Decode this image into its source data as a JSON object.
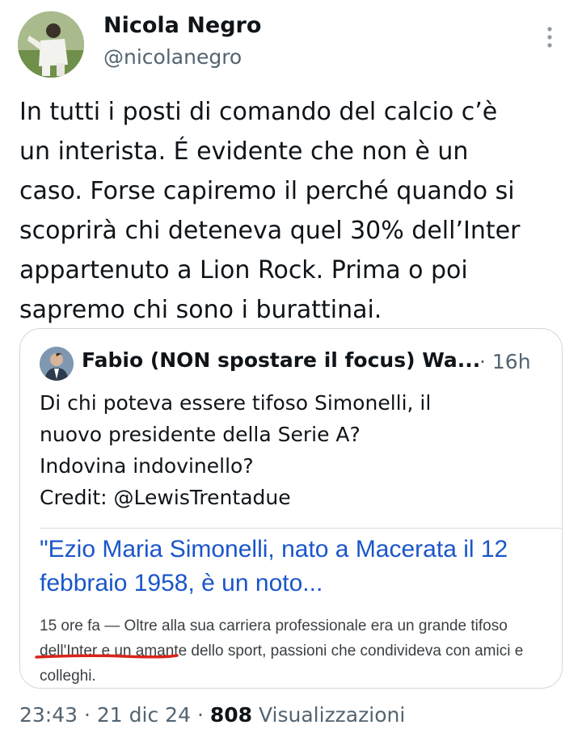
{
  "author": {
    "name": "Nicola Negro",
    "handle": "@nicolanegro"
  },
  "tweet": {
    "text": "In tutti i posti di comando del calcio c’è\nun interista. É evidente che non è un\ncaso. Forse capiremo il perché quando si\nscoprirà chi deteneva quel 30% dell’Inter\nappartenuto a Lion Rock. Prima o poi\nsapremo chi sono i burattinai."
  },
  "quoted": {
    "author_name": "Fabio (NON spostare il focus) Wa...",
    "time": "· 16h",
    "text": "Di chi poteva essere tifoso Simonelli, il\nnuovo presidente della Serie A?\nIndovina indovinello?\nCredit: @LewisTrentadue",
    "snippet": {
      "title": "\"Ezio Maria Simonelli, nato a Macerata il 12 febbraio 1958, è un noto...",
      "body_prefix": "15 ore fa — Oltre alla sua carriera professionale era un grande ",
      "highlight": "tifoso dell'Inter",
      "body_suffix": " e un amante dello sport, passioni che condivideva con amici e colleghi.",
      "underline_color": "#d9241b"
    }
  },
  "footer": {
    "time": "23:43",
    "date": "21 dic 24",
    "views_count": "808",
    "views_label": "Visualizzazioni"
  }
}
